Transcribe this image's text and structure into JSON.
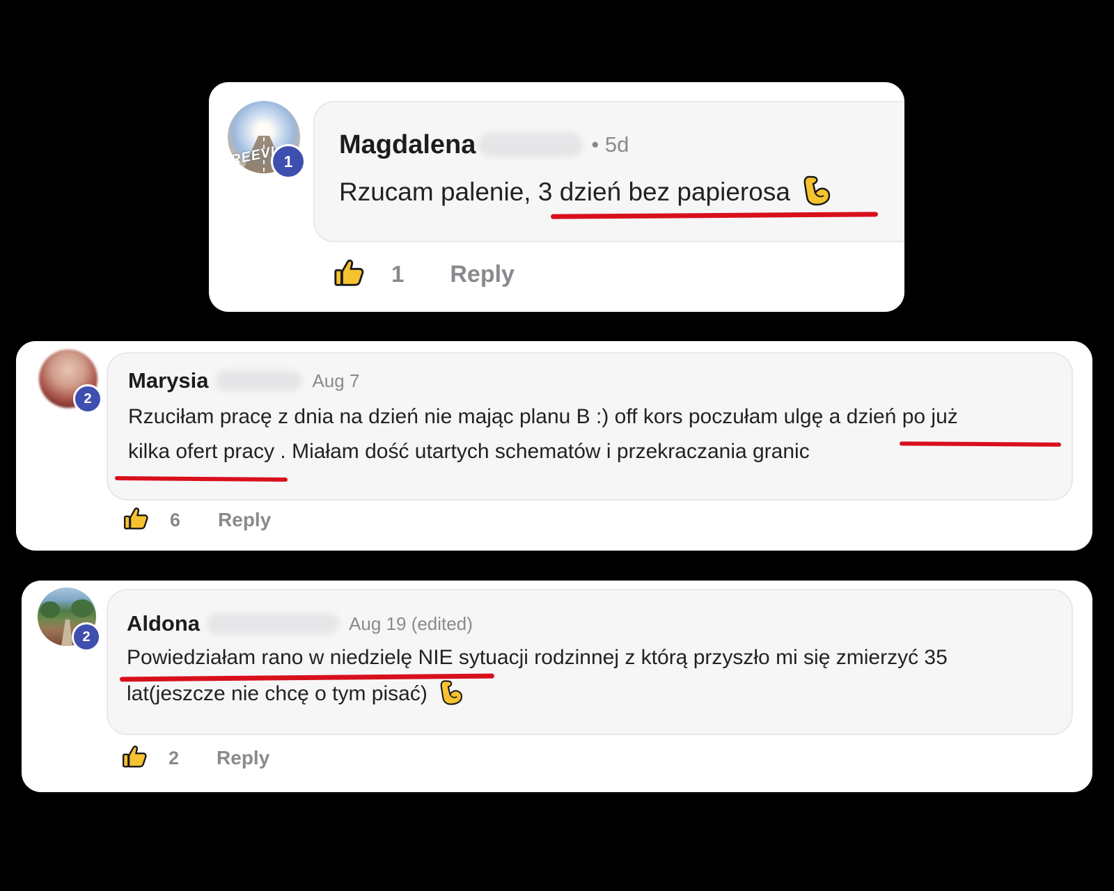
{
  "comments": [
    {
      "author": "Magdalena",
      "avatar_badge": "1",
      "avatar_label": "REEVI",
      "time": "• 5d",
      "text": "Rzucam palenie, 3 dzień bez papierosa",
      "emoji": "flexed-biceps-icon",
      "likes": "1",
      "reply_label": "Reply"
    },
    {
      "author": "Marysia",
      "avatar_badge": "2",
      "time": "Aug 7",
      "text_line1": "Rzuciłam pracę z dnia na dzień nie mając planu B :) off kors poczułam ulgę a dzień po już",
      "text_line2": "kilka ofert pracy . Miałam dość utartych schematów i przekraczania granic",
      "likes": "6",
      "reply_label": "Reply"
    },
    {
      "author": "Aldona",
      "avatar_badge": "2",
      "time": "Aug 19 (edited)",
      "text_line1": "Powiedziałam rano w niedzielę NIE sytuacji rodzinnej z którą przyszło mi się zmierzyć 35",
      "text_line2": "lat(jeszcze nie chcę o tym pisać)",
      "emoji": "flexed-biceps-icon",
      "likes": "2",
      "reply_label": "Reply"
    }
  ],
  "colors": {
    "background": "#000000",
    "card": "#ffffff",
    "bubble": "#f6f6f7",
    "underline": "#d8101c",
    "badge": "#3e4fb0",
    "emoji": "#f7c22f"
  }
}
